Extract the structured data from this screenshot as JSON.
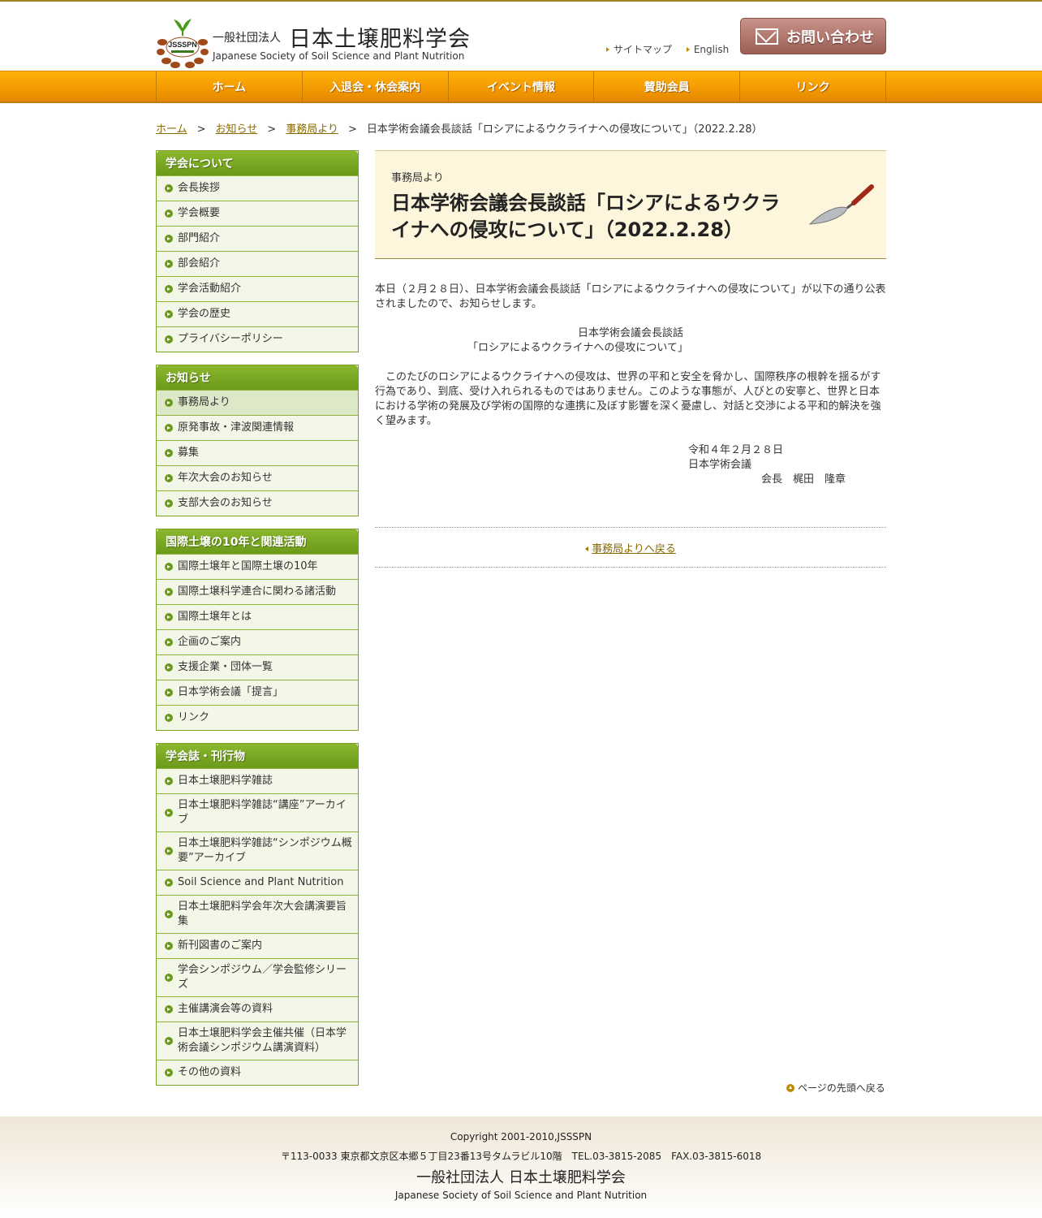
{
  "header": {
    "org_prefix": "一般社団法人",
    "org_name": "日本土壌肥料学会",
    "org_en": "Japanese Society of Soil Science and Plant Nutrition",
    "logo_text": "JSSSPN",
    "links": {
      "sitemap": "サイトマップ",
      "english": "English"
    },
    "contact": "お問い合わせ"
  },
  "nav": {
    "home": "ホーム",
    "membership": "入退会・休会案内",
    "events": "イベント情報",
    "supporters": "賛助会員",
    "links": "リンク"
  },
  "breadcrumb": {
    "home": "ホーム",
    "news": "お知らせ",
    "office": "事務局より",
    "sep": ">",
    "current": "日本学術会議会長談話「ロシアによるウクライナへの侵攻について」（2022.2.28）"
  },
  "sidebar": {
    "about": {
      "title": "学会について",
      "items": [
        "会長挨拶",
        "学会概要",
        "部門紹介",
        "部会紹介",
        "学会活動紹介",
        "学会の歴史",
        "プライバシーポリシー"
      ]
    },
    "news": {
      "title": "お知らせ",
      "items": [
        "事務局より",
        "原発事故・津波関連情報",
        "募集",
        "年次大会のお知らせ",
        "支部大会のお知らせ"
      ]
    },
    "iys": {
      "title": "国際土壌の10年と関連活動",
      "items": [
        "国際土壌年と国際土壌の10年",
        "国際土壌科学連合に関わる諸活動",
        "国際土壌年とは",
        "企画のご案内",
        "支援企業・団体一覧",
        "日本学術会議「提言」",
        "リンク"
      ]
    },
    "pubs": {
      "title": "学会誌・刊行物",
      "items": [
        "日本土壌肥料学雑誌",
        "日本土壌肥料学雑誌“講座”アーカイブ",
        "日本土壌肥料学雑誌“シンポジウム概要”アーカイブ",
        "Soil Science and Plant Nutrition",
        "日本土壌肥料学会年次大会講演要旨集",
        "新刊図書のご案内",
        "学会シンポジウム／学会監修シリーズ",
        "主催講演会等の資料",
        "日本土壌肥料学会主催共催（日本学術会議シンポジウム講演資料）",
        "その他の資料"
      ]
    }
  },
  "article": {
    "category": "事務局より",
    "title": "日本学術会議会長談話「ロシアによるウクライナへの侵攻について」（2022.2.28）",
    "intro": "本日（２月２８日）、日本学術会議会長談話「ロシアによるウクライナへの侵攻について」が以下の通り公表されましたので、お知らせします。",
    "statement_title_1": "日本学術会議会長談話",
    "statement_title_2": "「ロシアによるウクライナへの侵攻について」",
    "statement_body": "　このたびのロシアによるウクライナへの侵攻は、世界の平和と安全を脅かし、国際秩序の根幹を揺るがす行為であり、到底、受け入れられるものではありません。このような事態が、人びとの安寧と、世界と日本における学術の発展及び学術の国際的な連携に及ぼす影響を深く憂慮し、対話と交渉による平和的解決を強く望みます。",
    "date": "令和４年２月２８日",
    "org": "日本学術会議",
    "signer": "会長　梶田　隆章",
    "back_link": "事務局よりへ戻る"
  },
  "pagetop": "ページの先頭へ戻る",
  "footer": {
    "copyright": "Copyright 2001-2010,JSSSPN",
    "address": "〒113-0033 東京都文京区本郷５丁目23番13号タムラビル10階　TEL.03-3815-2085　FAX.03-3815-6018",
    "name": "一般社団法人  日本土壌肥料学会",
    "name_en": "Japanese Society of Soil Science and Plant Nutrition"
  }
}
